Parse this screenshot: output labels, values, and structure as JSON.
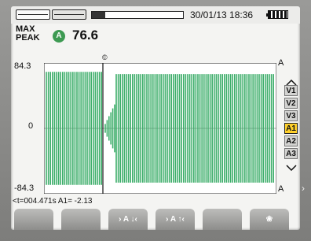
{
  "header": {
    "datetime": "30/01/13 18:36",
    "progress": 0.15,
    "tabs": [
      {
        "icon": "waveform-tab-icon"
      },
      {
        "icon": "harmonics-tab-icon"
      }
    ]
  },
  "mode_label_line1": "MAX",
  "mode_label_line2": "PEAK",
  "channel_badge": "A",
  "reading": "76.6",
  "y_axis": {
    "top": "84.3",
    "mid": "0",
    "bottom": "-84.3"
  },
  "cursor_marker": "©",
  "unit_top": "A",
  "unit_bottom": "A",
  "channels": [
    {
      "label": "V1",
      "active": false
    },
    {
      "label": "V2",
      "active": false
    },
    {
      "label": "V3",
      "active": false
    },
    {
      "label": "A1",
      "active": true
    },
    {
      "label": "A2",
      "active": false
    },
    {
      "label": "A3",
      "active": false
    }
  ],
  "cursor_info": "<t=004.471s A1= -2.13",
  "softkeys": [
    "",
    "",
    "› A ↓‹",
    "› A ↑‹",
    "",
    "❀"
  ],
  "side_arrow": "›",
  "colors": {
    "trace": "#3dae6a",
    "active_channel": "#ffd02a",
    "badge": "#3d9a52"
  },
  "chart_data": {
    "type": "line",
    "ylim": [
      -84.3,
      84.3
    ],
    "ylabel": "A",
    "description_values": {
      "steady_peak": 76.6,
      "cursor_value": -2.13,
      "cursor_time_s": 4.471
    }
  }
}
